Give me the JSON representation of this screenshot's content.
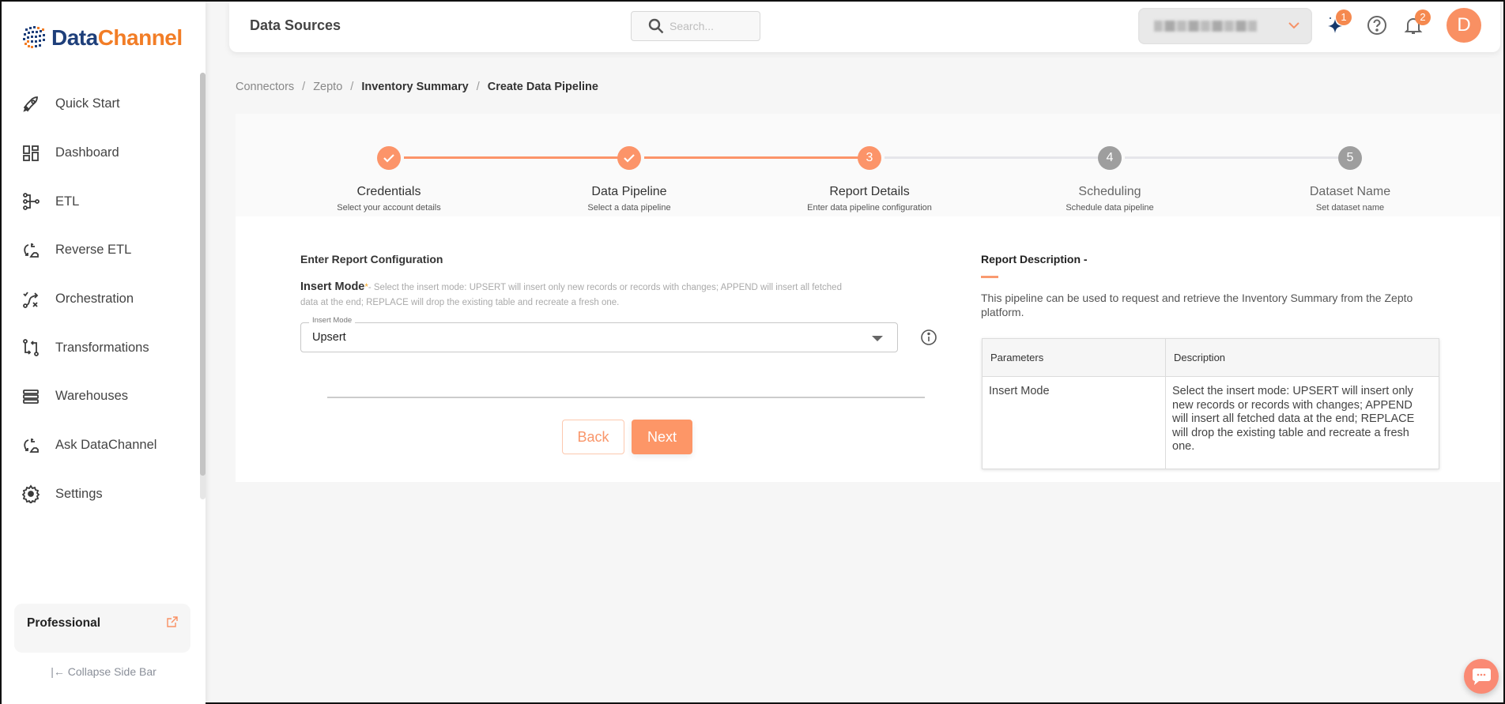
{
  "brand": {
    "name_part1": "Data",
    "name_part2": "Channel"
  },
  "sidebar": {
    "items": [
      {
        "label": "Quick Start",
        "icon": "rocket-icon"
      },
      {
        "label": "Dashboard",
        "icon": "dashboard-icon"
      },
      {
        "label": "ETL",
        "icon": "etl-icon"
      },
      {
        "label": "Reverse ETL",
        "icon": "reverse-etl-icon"
      },
      {
        "label": "Orchestration",
        "icon": "orchestration-icon"
      },
      {
        "label": "Transformations",
        "icon": "transformations-icon"
      },
      {
        "label": "Warehouses",
        "icon": "warehouses-icon"
      },
      {
        "label": "Ask DataChannel",
        "icon": "ask-datachannel-icon"
      },
      {
        "label": "Settings",
        "icon": "gear-icon"
      }
    ],
    "plan": {
      "label": "Professional"
    },
    "collapse_label": "|← Collapse Side Bar"
  },
  "header": {
    "title": "Data Sources",
    "search_placeholder": "Search...",
    "workspace_value": "(blurred)",
    "ai_badge": "1",
    "notifications_badge": "2",
    "avatar_initial": "D"
  },
  "breadcrumb": [
    {
      "label": "Connectors"
    },
    {
      "label": "Zepto"
    },
    {
      "label": "Inventory Summary"
    },
    {
      "label": "Create Data Pipeline"
    }
  ],
  "stepper": {
    "steps": [
      {
        "number": "1",
        "title": "Credentials",
        "subtitle": "Select your account details",
        "status": "complete"
      },
      {
        "number": "2",
        "title": "Data Pipeline",
        "subtitle": "Select a data pipeline",
        "status": "complete"
      },
      {
        "number": "3",
        "title": "Report Details",
        "subtitle": "Enter data pipeline configuration",
        "status": "active"
      },
      {
        "number": "4",
        "title": "Scheduling",
        "subtitle": "Schedule data pipeline",
        "status": "pending"
      },
      {
        "number": "5",
        "title": "Dataset Name",
        "subtitle": "Set dataset name",
        "status": "pending"
      }
    ]
  },
  "form": {
    "heading": "Enter Report Configuration",
    "insert_mode": {
      "label": "Insert Mode",
      "required_mark": "*",
      "help": "- Select the insert mode: UPSERT will insert only new records or records with changes; APPEND will insert all fetched data at the end; REPLACE will drop the existing table and recreate a fresh one.",
      "legend": "Insert Mode",
      "value": "Upsert"
    },
    "back_label": "Back",
    "next_label": "Next"
  },
  "description": {
    "title": "Report Description -",
    "text": "This pipeline can be used to request and retrieve the Inventory Summary from the Zepto platform.",
    "table": {
      "headers": [
        "Parameters",
        "Description"
      ],
      "rows": [
        [
          "Insert Mode",
          "Select the insert mode: UPSERT will insert only new records or records with changes; APPEND will insert all fetched data at the end; REPLACE will drop the existing table and recreate a fresh one."
        ]
      ]
    }
  },
  "colors": {
    "accent": "#fd9667",
    "brand_blue": "#1e3f7a",
    "brand_orange": "#f27d26",
    "step_pending": "#9e9e9e",
    "line_pending": "#e6e6ea"
  }
}
